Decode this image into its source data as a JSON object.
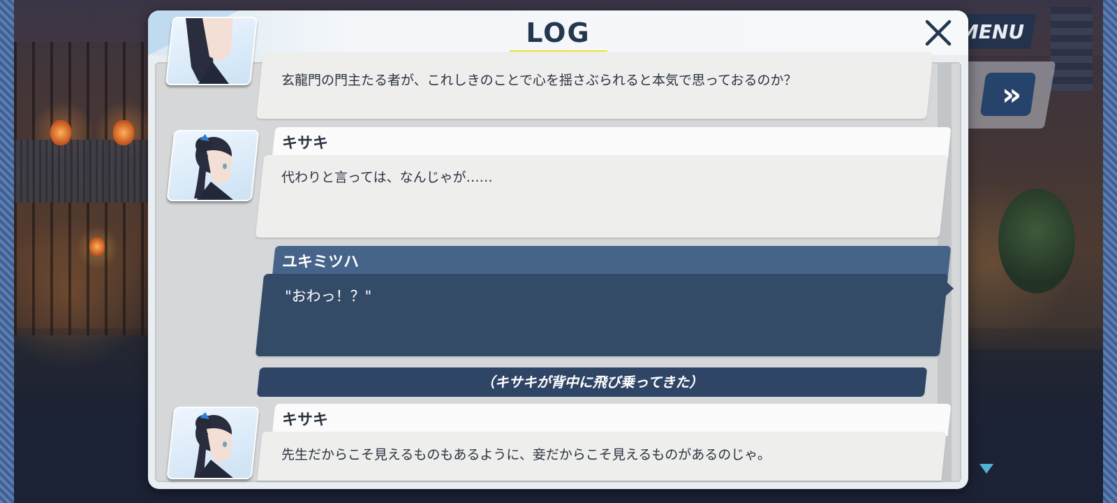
{
  "game_ui": {
    "menu_label": "MENU",
    "fast_forward_glyph": "»"
  },
  "log": {
    "title": "LOG",
    "close_glyph": "✕",
    "entries": [
      {
        "speaker": "",
        "text": "玄龍門の門主たる者が、これしきのことで心を揺さぶられると本気で思っておるのか？"
      },
      {
        "speaker": "キサキ",
        "text": "代わりと言っては、なんじゃが……"
      },
      {
        "speaker": "ユキミツハ",
        "text": "\"おわっ！？\""
      },
      {
        "narration": "（キサキが背中に飛び乗ってきた）"
      },
      {
        "speaker": "キサキ",
        "text": "先生だからこそ見えるものもあるように、妾だからこそ見えるものがあるのじゃ。"
      }
    ]
  },
  "colors": {
    "title_underline": "#f6df2e",
    "player_bubble": "#344b68",
    "player_name_bar": "#46648a",
    "npc_bubble": "#eeeeec",
    "narration_bar": "#2f4566"
  }
}
